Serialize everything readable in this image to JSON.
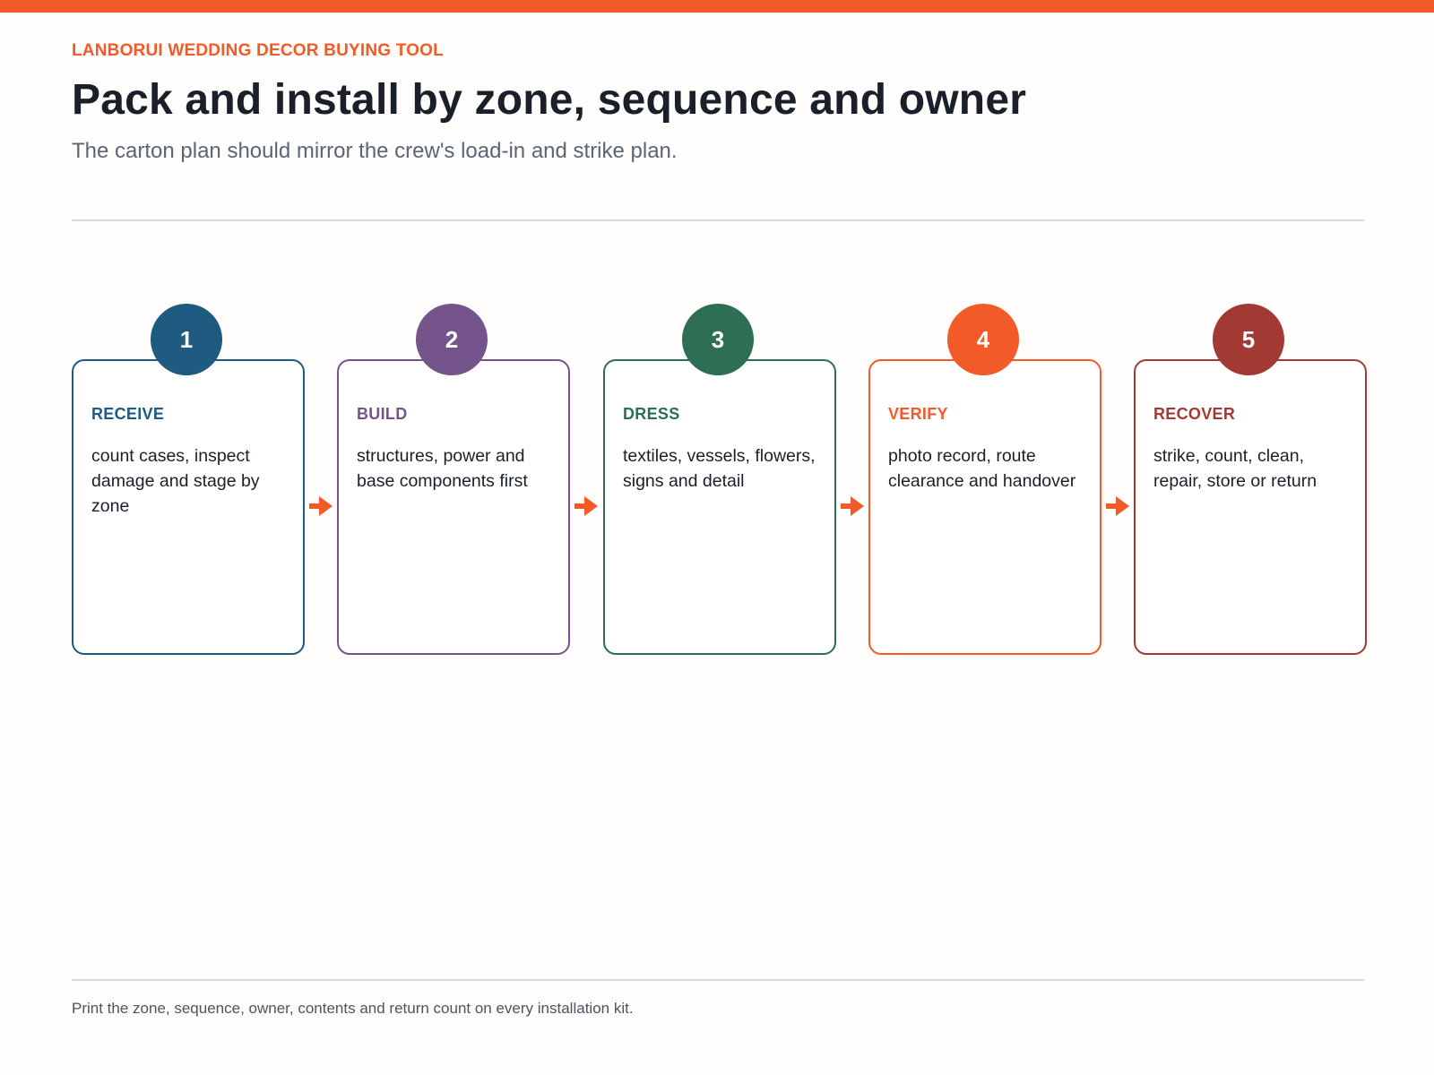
{
  "header": {
    "eyebrow": "LANBORUI WEDDING DECOR BUYING TOOL",
    "title": "Pack and install by zone, sequence and owner",
    "subtitle": "The carton plan should mirror the crew's load-in and strike plan."
  },
  "steps": [
    {
      "number": "1",
      "name": "RECEIVE",
      "description": "count cases, inspect damage and stage by zone",
      "color": "#1F5A80"
    },
    {
      "number": "2",
      "name": "BUILD",
      "description": "structures, power and base components first",
      "color": "#74548A"
    },
    {
      "number": "3",
      "name": "DRESS",
      "description": "textiles, vessels, flowers, signs and detail",
      "color": "#2D6E55"
    },
    {
      "number": "4",
      "name": "VERIFY",
      "description": "photo record, route clearance and handover",
      "color": "#F25A28"
    },
    {
      "number": "5",
      "name": "RECOVER",
      "description": "strike, count, clean, repair, store or return",
      "color": "#A23A33"
    }
  ],
  "connector": {
    "icon": "arrow-right-icon",
    "color": "#F25A28"
  },
  "footer": {
    "note": "Print the zone, sequence, owner, contents and return count on every installation kit."
  },
  "colors": {
    "accent": "#F25A28",
    "title": "#1A202A",
    "subtitle": "#5A6675"
  }
}
